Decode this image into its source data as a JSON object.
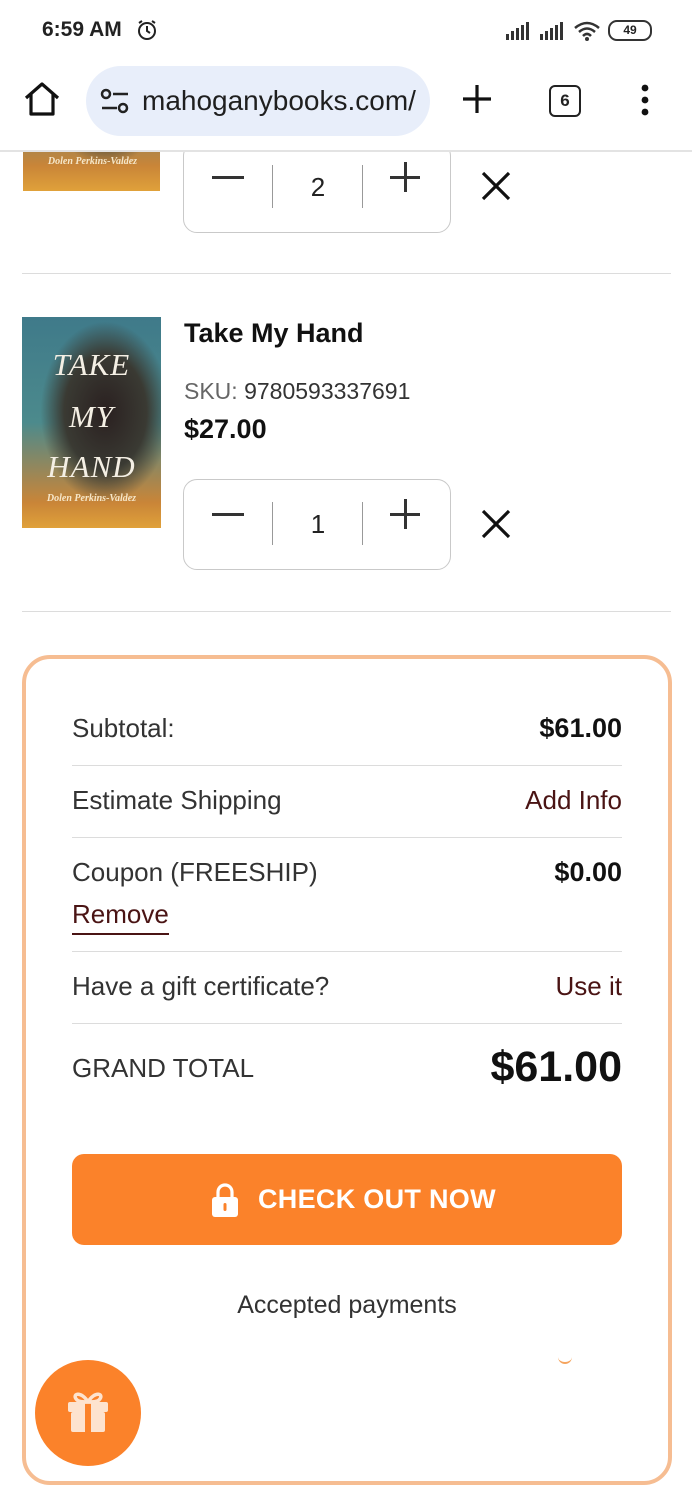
{
  "status_bar": {
    "time": "6:59 AM",
    "battery": "49"
  },
  "browser": {
    "url": "mahoganybooks.com/",
    "tab_count": "6"
  },
  "cart": {
    "items": [
      {
        "cover_author": "Dolen Perkins-Valdez",
        "quantity": "2"
      },
      {
        "title": "Take My Hand",
        "sku_label": "SKU:",
        "sku": "9780593337691",
        "price": "$27.00",
        "cover_title_1": "TAKE",
        "cover_title_2": "MY",
        "cover_title_3": "HAND",
        "cover_author": "Dolen Perkins-Valdez",
        "quantity": "1"
      }
    ]
  },
  "summary": {
    "subtotal_label": "Subtotal:",
    "subtotal_value": "$61.00",
    "shipping_label": "Estimate Shipping",
    "shipping_link": "Add Info",
    "coupon_label": "Coupon (FREESHIP)",
    "coupon_value": "$0.00",
    "coupon_remove": "Remove",
    "gift_label": "Have a gift certificate?",
    "gift_link": "Use it",
    "grand_total_label": "GRAND TOTAL",
    "grand_total_value": "$61.00",
    "checkout_label": "CHECK OUT NOW",
    "accepted_payments": "Accepted payments"
  },
  "icons": {
    "home": "home-icon",
    "tune": "site-settings-icon",
    "plus": "new-tab-icon",
    "menu": "more-vert-icon",
    "lock": "lock-icon",
    "gift": "gift-icon",
    "close": "close-icon",
    "alarm": "alarm-icon"
  },
  "colors": {
    "accent": "#fb822a",
    "summary_border": "#f6bd92",
    "link": "#4a1414"
  }
}
